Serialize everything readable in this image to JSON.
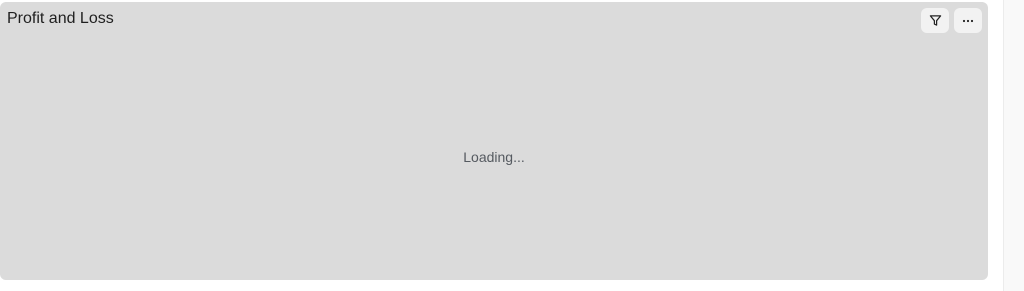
{
  "card": {
    "title": "Profit and Loss",
    "loading_text": "Loading...",
    "actions": [
      {
        "icon": "filter-icon",
        "label": "Filter"
      },
      {
        "icon": "more-horizontal-icon",
        "label": "More options"
      }
    ]
  },
  "colors": {
    "card_background": "#dbdbdb",
    "button_background": "#f2f2f2",
    "title_text": "#1f1f1f",
    "loading_text": "#555a60"
  }
}
